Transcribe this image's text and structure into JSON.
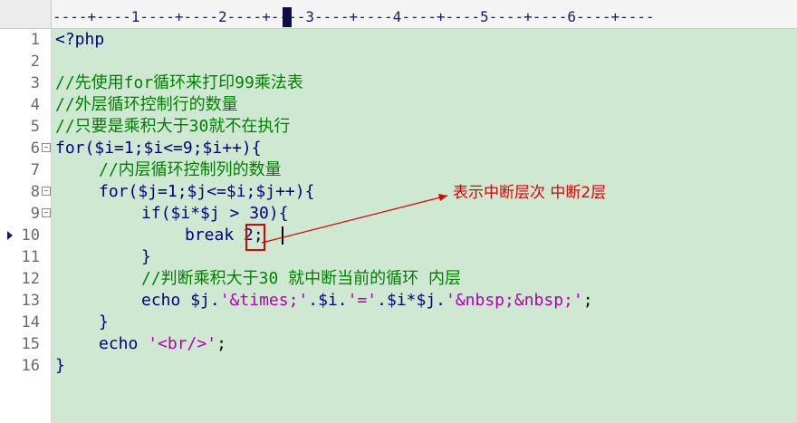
{
  "ruler": {
    "text": "----+----1----+----2----+----3----+----4----+----5----+----6----+----"
  },
  "gutter": {
    "line_numbers": [
      "1",
      "2",
      "3",
      "4",
      "5",
      "6",
      "7",
      "8",
      "9",
      "10",
      "11",
      "12",
      "13",
      "14",
      "15",
      "16"
    ],
    "fold_markers": [
      "−",
      "−",
      "−"
    ]
  },
  "code": {
    "l1": "<?php",
    "l3": "//先使用for循环来打印99乘法表",
    "l4": "//外层循环控制行的数量",
    "l5": "//只要是乘积大于30就不在执行",
    "l6_for": "for",
    "l6_rest": "($i=1;$i<=9;$i++){",
    "l7": "//内层循环控制列的数量",
    "l8_for": "for",
    "l8_rest": "($j=1;$j<=$i;$j++){",
    "l9_if": "if",
    "l9_rest": "($i*$j > 30){",
    "l10_break": "break",
    "l10_num": "2",
    "l10_semi": ";",
    "l11": "}",
    "l12": "//判断乘积大于30 就中断当前的循环 内层",
    "l13_echo": "echo",
    "l13_a": " $j.",
    "l13_s1": "'&times;'",
    "l13_b": ".$i.",
    "l13_s2": "'='",
    "l13_c": ".$i*$j.",
    "l13_s3": "'&nbsp;&nbsp;'",
    "l13_d": ";",
    "l14": "}",
    "l15_echo": "echo",
    "l15_s": "'<br/>'",
    "l15_d": ";",
    "l16": "}"
  },
  "annotation": {
    "text": "表示中断层次  中断2层"
  },
  "colors": {
    "editor_bg": "#cfe8d2",
    "keyword": "#000080",
    "comment": "#008000",
    "string": "#b000b0",
    "annotation": "#e00000"
  }
}
